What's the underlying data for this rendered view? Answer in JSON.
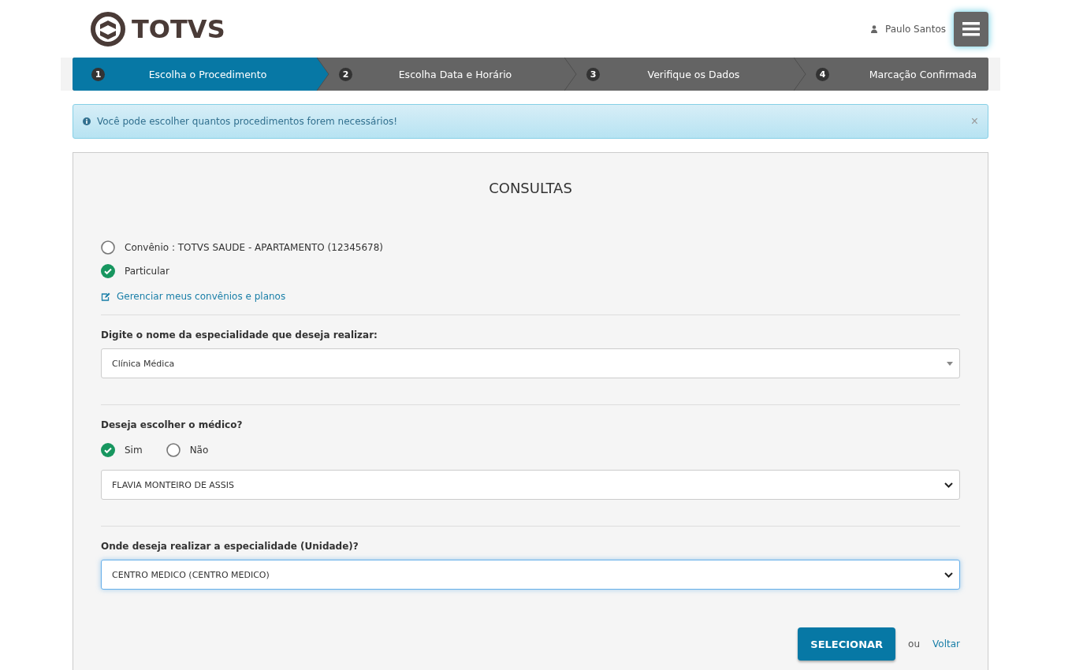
{
  "header": {
    "logo_text": "TOTVS",
    "user_name": "Paulo Santos"
  },
  "steps": [
    {
      "number": "1",
      "label": "Escolha o Procedimento",
      "selected": true
    },
    {
      "number": "2",
      "label": "Escolha Data e Horário",
      "selected": false
    },
    {
      "number": "3",
      "label": "Verifique os Dados",
      "selected": false
    },
    {
      "number": "4",
      "label": "Marcação Confirmada",
      "selected": false
    }
  ],
  "alert": {
    "message": "Você pode escolher quantos procedimentos forem necessários!",
    "close": "×"
  },
  "panel": {
    "title": "CONSULTAS",
    "plan_options": [
      {
        "label": "Convênio : TOTVS SAUDE - APARTAMENTO (12345678)",
        "selected": false
      },
      {
        "label": "Particular",
        "selected": true
      }
    ],
    "manage_link": "Gerenciar meus convênios e planos",
    "specialty": {
      "label": "Digite o nome da especialidade que deseja realizar:",
      "kind": "combo",
      "value": "Clínica Médica",
      "focused": false
    },
    "doctor": {
      "label": "Deseja escolher o médico?",
      "options": [
        {
          "label": "Sim",
          "selected": true
        },
        {
          "label": "Não",
          "selected": false
        }
      ],
      "field": {
        "kind": "select",
        "value": "FLAVIA MONTEIRO DE ASSIS",
        "focused": false
      }
    },
    "unit": {
      "label": "Onde deseja realizar a especialidade (Unidade)?",
      "kind": "select",
      "value": "CENTRO MEDICO (CENTRO MEDICO)",
      "focused": true
    },
    "submit": "SELECIONAR",
    "or": "ou",
    "back": "Voltar"
  }
}
